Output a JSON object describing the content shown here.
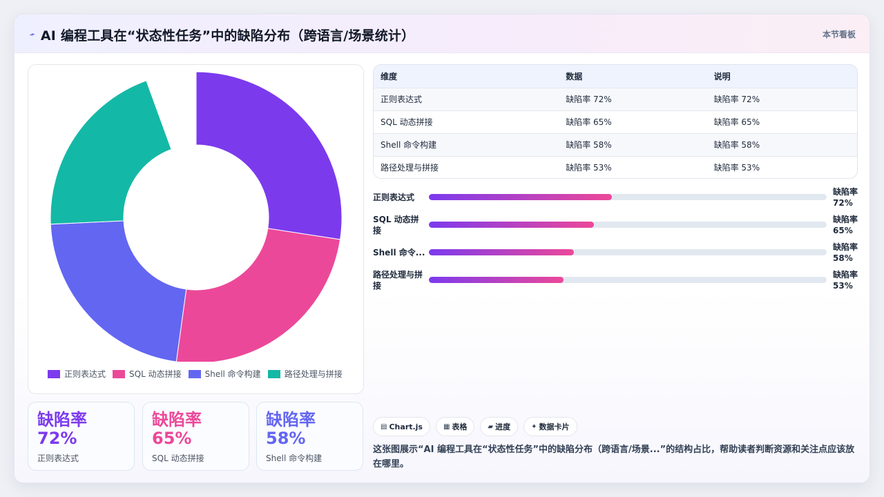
{
  "header": {
    "title": "AI 编程工具在“状态性任务”中的缺陷分布（跨语言/场景统计）",
    "title_icon": "trend-arrow-icon",
    "right_label": "本节看板"
  },
  "colors": {
    "violet": "#7c3aed",
    "pink": "#ec4899",
    "indigo": "#6366f1",
    "teal": "#14b8a6"
  },
  "chart_data": {
    "type": "pie",
    "variant": "doughnut",
    "categories": [
      "正则表达式",
      "SQL 动态拼接",
      "Shell 命令构建",
      "路径处理与拼接"
    ],
    "values": [
      72,
      65,
      58,
      53
    ],
    "colors": [
      "#7c3aed",
      "#ec4899",
      "#6366f1",
      "#14b8a6"
    ],
    "legend_position": "bottom",
    "start_angle_deg": 0,
    "gap_after_last": true
  },
  "stats": [
    {
      "big": "缺陷率 72%",
      "label": "正则表达式",
      "color": "#7c3aed"
    },
    {
      "big": "缺陷率 65%",
      "label": "SQL 动态拼接",
      "color": "#ec4899"
    },
    {
      "big": "缺陷率 58%",
      "label": "Shell 命令构建",
      "color": "#6366f1"
    }
  ],
  "table": {
    "headers": [
      "维度",
      "数据",
      "说明"
    ],
    "rows": [
      [
        "正则表达式",
        "缺陷率 72%",
        "缺陷率 72%"
      ],
      [
        "SQL 动态拼接",
        "缺陷率 65%",
        "缺陷率 65%"
      ],
      [
        "Shell 命令构建",
        "缺陷率 58%",
        "缺陷率 58%"
      ],
      [
        "路径处理与拼接",
        "缺陷率 53%",
        "缺陷率 53%"
      ]
    ]
  },
  "progress": [
    {
      "label": "正则表达式",
      "value_text": "缺陷率 72%",
      "fraction": 0.46
    },
    {
      "label": "SQL 动态拼接",
      "value_text": "缺陷率 65%",
      "fraction": 0.415
    },
    {
      "label": "Shell 命令...",
      "value_text": "缺陷率 58%",
      "fraction": 0.365
    },
    {
      "label": "路径处理与拼接",
      "value_text": "缺陷率 53%",
      "fraction": 0.338
    }
  ],
  "chips": [
    {
      "icon": "▤",
      "label": "Chart.js"
    },
    {
      "icon": "▦",
      "label": "表格"
    },
    {
      "icon": "▰",
      "label": "进度"
    },
    {
      "icon": "✦",
      "label": "数据卡片"
    }
  ],
  "description": "这张图展示“AI 编程工具在“状态性任务”中的缺陷分布（跨语言/场景...”的结构占比，帮助读者判断资源和关注点应该放在哪里。"
}
